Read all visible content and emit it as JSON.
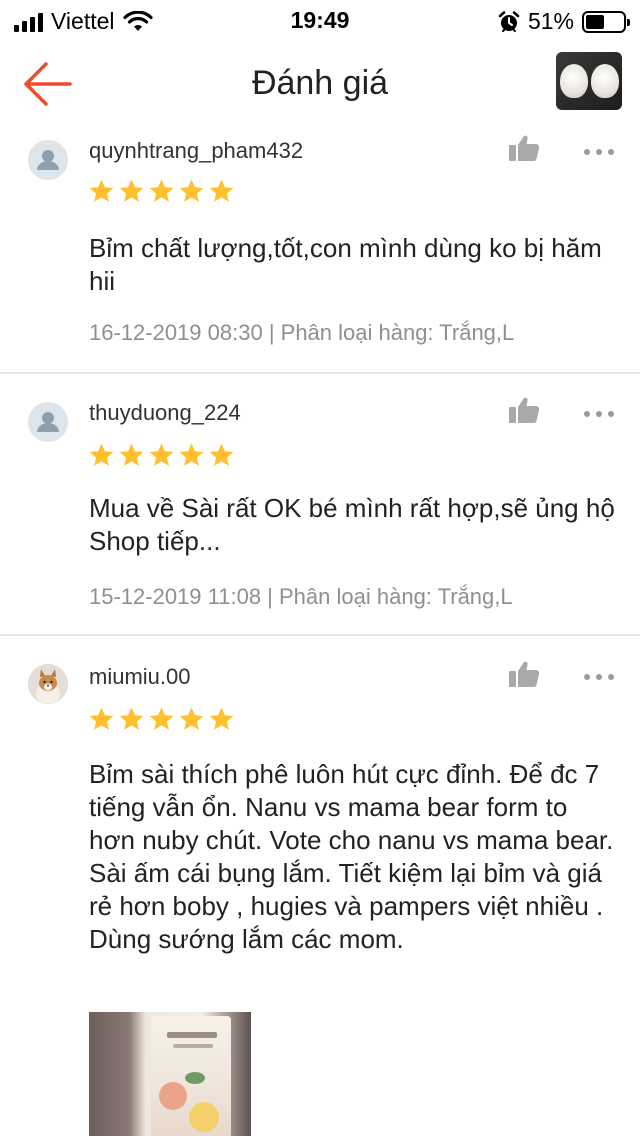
{
  "status_bar": {
    "carrier": "Viettel",
    "time": "19:49",
    "battery_percent": "51%",
    "battery_level": 0.51
  },
  "header": {
    "title": "Đánh giá",
    "back_icon": "arrow-left-icon",
    "accent_color": "#ee4d2d"
  },
  "star_color": "#ffc02b",
  "reviews": [
    {
      "username": "quynhtrang_pham432",
      "rating": 5,
      "text": "Bỉm chất lượng,tốt,con mình dùng ko bị hăm hii",
      "meta": "16-12-2019 08:30 | Phân loại hàng: Trắng,L",
      "avatar": "default-user-avatar"
    },
    {
      "username": "thuyduong_224",
      "rating": 5,
      "text": "Mua về Sài rất OK bé mình rất hợp,sẽ ủng hộ Shop tiếp...",
      "meta": "15-12-2019 11:08 | Phân loại hàng: Trắng,L",
      "avatar": "default-user-avatar"
    },
    {
      "username": "miumiu.00",
      "rating": 5,
      "text": "Bỉm sài thích phê luôn hút cực đỉnh. Để đc 7 tiếng vẫn ổn. Nanu vs mama bear form to hơn nuby chút. Vote cho nanu vs mama bear. Sài ấm cái bụng lắm. Tiết kiệm lại bỉm và giá rẻ hơn boby , hugies và pampers việt nhiều . Dùng sướng lắm các mom.",
      "avatar": "dog-photo-avatar",
      "has_photo": true
    }
  ]
}
